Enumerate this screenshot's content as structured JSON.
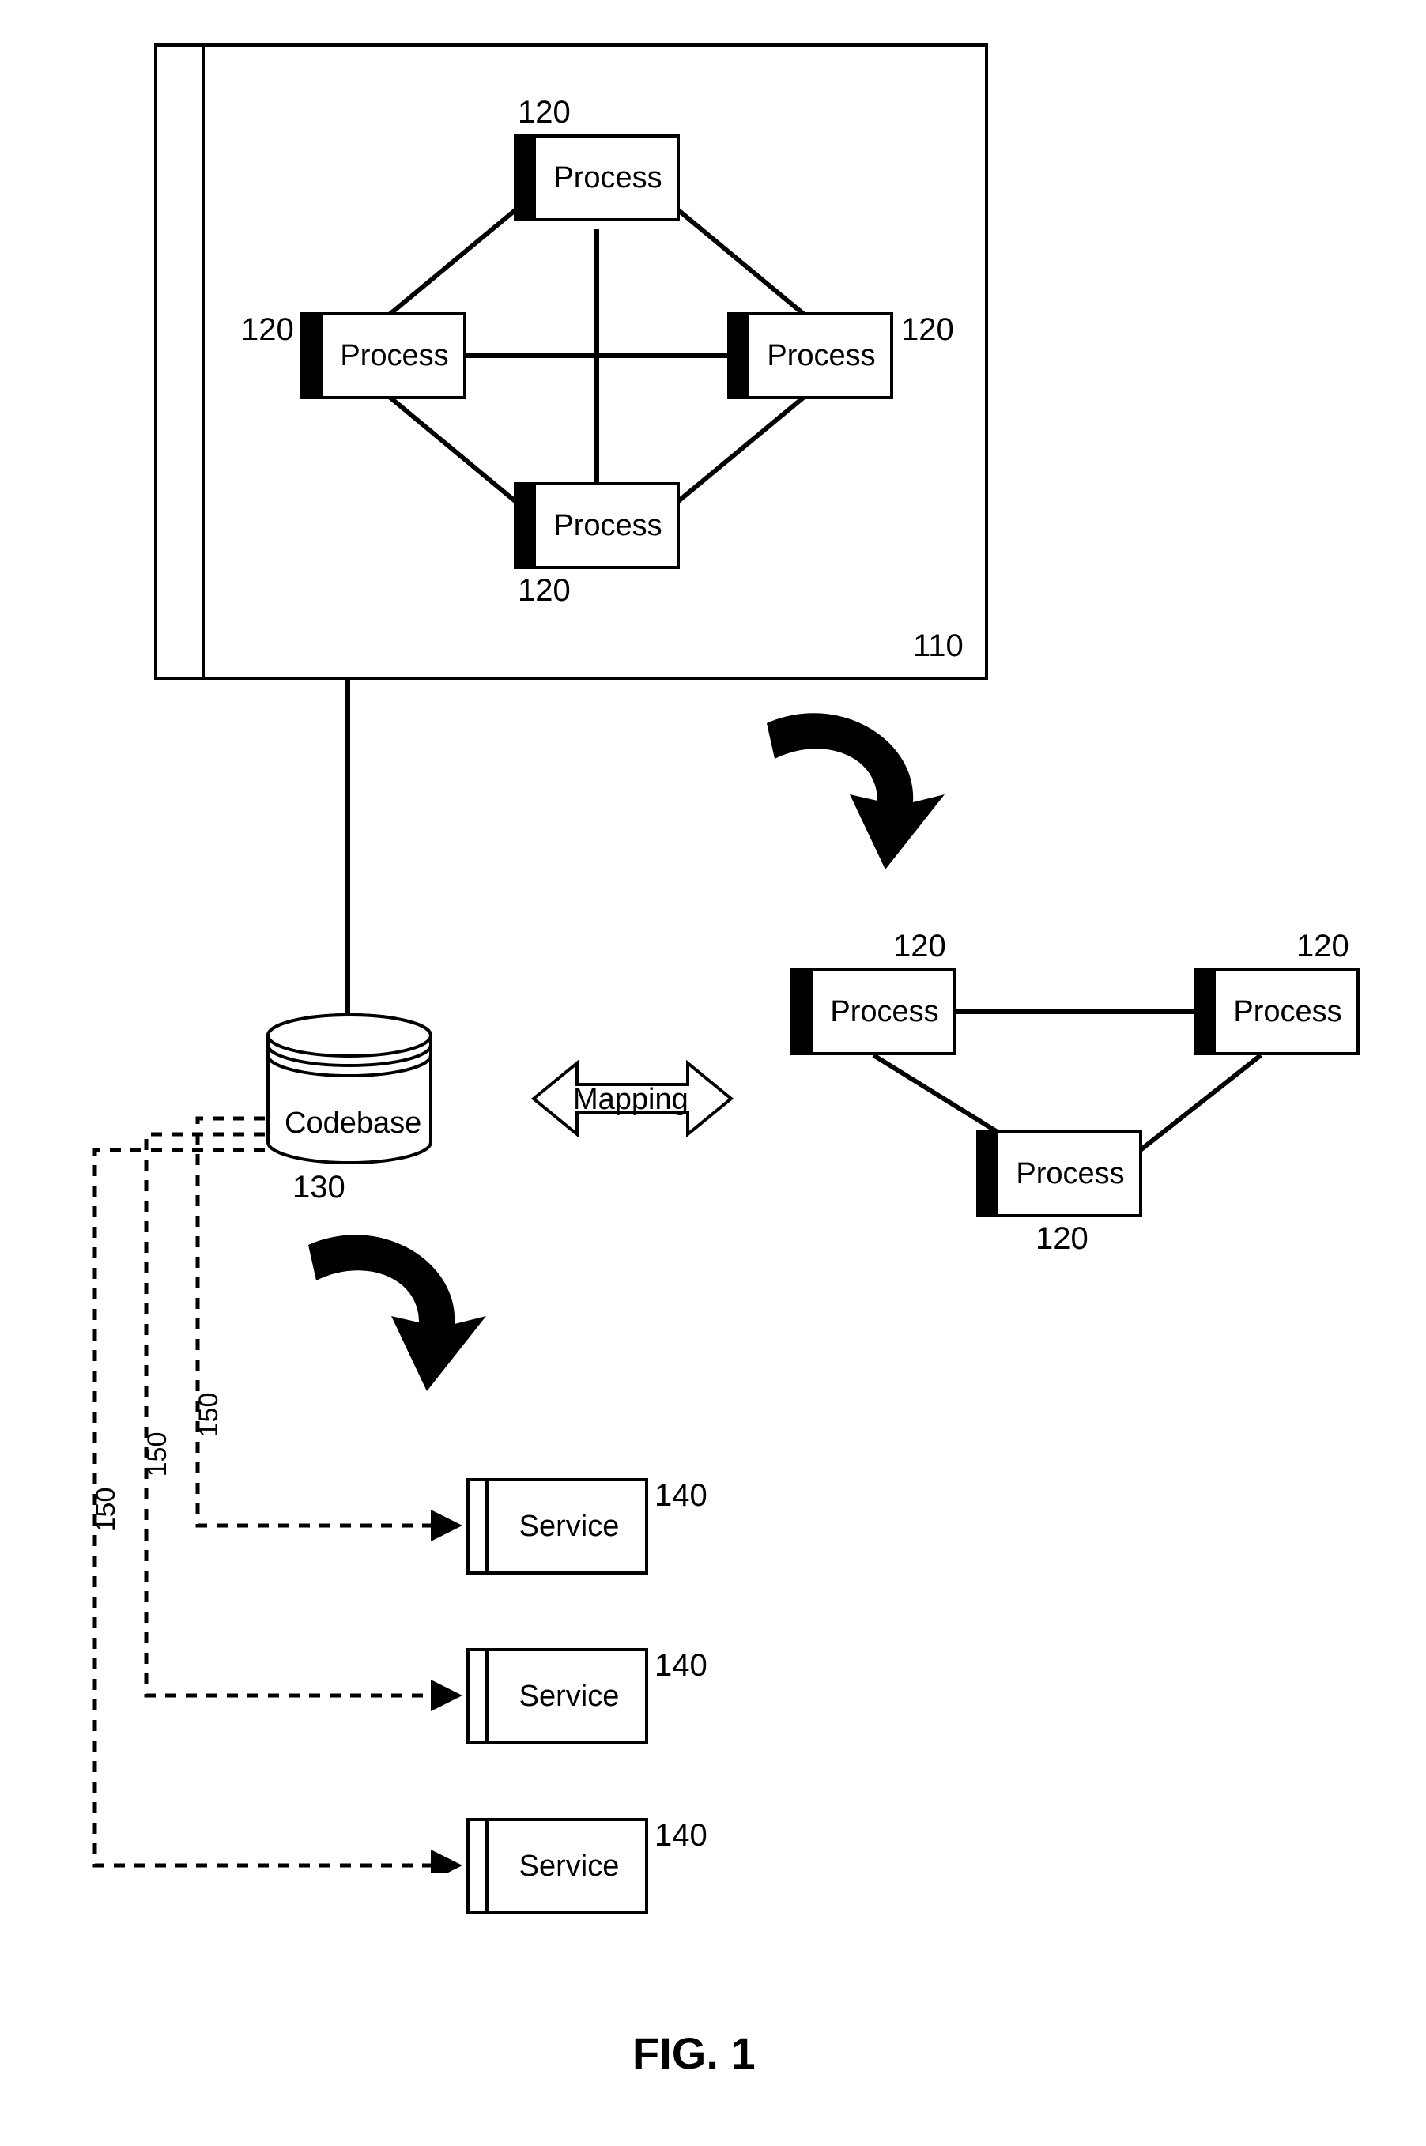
{
  "figure_title": "FIG. 1",
  "labels": {
    "process": "Process",
    "service": "Service",
    "codebase": "Codebase",
    "mapping": "Mapping"
  },
  "ref_nums": {
    "monolith": "110",
    "process": "120",
    "codebase": "130",
    "service": "140",
    "dashed_connector": "150"
  },
  "diagram": {
    "description": "A monolithic application (110) containing interconnected processes (120) is decomposed. The processes are mapped from a codebase (130) to a reduced process graph, and the codebase is refactored via connectors (150) into individual services (140).",
    "monolith_container": {
      "ref": "110",
      "processes": 4,
      "process_ref": "120",
      "internal_connections": [
        [
          "top",
          "left"
        ],
        [
          "top",
          "right"
        ],
        [
          "top",
          "bottom"
        ],
        [
          "left",
          "right"
        ],
        [
          "left",
          "bottom"
        ],
        [
          "right",
          "bottom"
        ]
      ]
    },
    "extracted_process_graph": {
      "processes": 3,
      "process_ref": "120",
      "connections": [
        [
          "left",
          "right"
        ],
        [
          "left",
          "bottom"
        ],
        [
          "right",
          "bottom"
        ]
      ]
    },
    "codebase": {
      "ref": "130",
      "connected_to": "monolith_container"
    },
    "mapping_arrow": {
      "between": [
        "codebase",
        "extracted_process_graph"
      ],
      "bidirectional": true
    },
    "transition_arrows": [
      {
        "from": "monolith_container",
        "to": "extracted_process_graph",
        "style": "thick-curved"
      },
      {
        "from": "codebase",
        "to": "services",
        "style": "thick-curved"
      }
    ],
    "services": {
      "count": 3,
      "service_ref": "140",
      "dashed_links_from_codebase_ref": "150"
    }
  }
}
